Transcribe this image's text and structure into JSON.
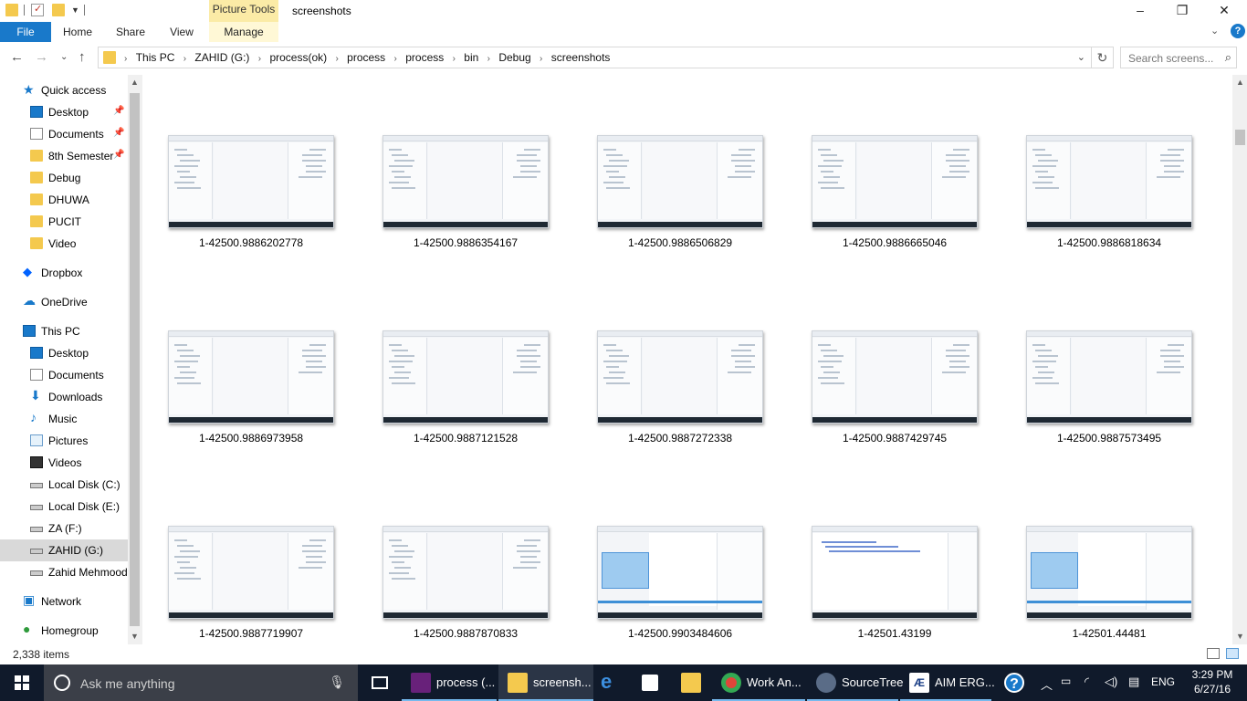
{
  "window": {
    "title": "screenshots",
    "context_tab": "Picture Tools"
  },
  "ribbon": {
    "tabs": [
      {
        "label": "File"
      },
      {
        "label": "Home"
      },
      {
        "label": "Share"
      },
      {
        "label": "View"
      },
      {
        "label": "Manage"
      }
    ]
  },
  "address": {
    "crumbs": [
      "This PC",
      "ZAHID (G:)",
      "process(ok)",
      "process",
      "process",
      "bin",
      "Debug",
      "screenshots"
    ]
  },
  "search": {
    "placeholder": "Search screens..."
  },
  "nav": {
    "items": [
      {
        "label": "Quick access",
        "icon": "star-icon",
        "pinned": false
      },
      {
        "label": "Desktop",
        "icon": "desktop-icon",
        "pinned": true
      },
      {
        "label": "Documents",
        "icon": "documents-icon",
        "pinned": true
      },
      {
        "label": "8th Semester",
        "icon": "folder-icon",
        "pinned": true
      },
      {
        "label": "Debug",
        "icon": "folder-icon",
        "pinned": false
      },
      {
        "label": "DHUWA",
        "icon": "folder-icon",
        "pinned": false
      },
      {
        "label": "PUCIT",
        "icon": "folder-icon",
        "pinned": false
      },
      {
        "label": "Video",
        "icon": "folder-icon",
        "pinned": false
      },
      {
        "label": "Dropbox",
        "icon": "dropbox-icon",
        "pinned": false
      },
      {
        "label": "OneDrive",
        "icon": "cloud-icon",
        "pinned": false
      },
      {
        "label": "This PC",
        "icon": "computer-icon",
        "pinned": false
      },
      {
        "label": "Desktop",
        "icon": "desktop-icon",
        "pinned": false
      },
      {
        "label": "Documents",
        "icon": "documents-icon",
        "pinned": false
      },
      {
        "label": "Downloads",
        "icon": "downloads-icon",
        "pinned": false
      },
      {
        "label": "Music",
        "icon": "music-icon",
        "pinned": false
      },
      {
        "label": "Pictures",
        "icon": "pictures-icon",
        "pinned": false
      },
      {
        "label": "Videos",
        "icon": "videos-icon",
        "pinned": false
      },
      {
        "label": "Local Disk (C:)",
        "icon": "drive-icon",
        "pinned": false
      },
      {
        "label": "Local Disk (E:)",
        "icon": "drive-icon",
        "pinned": false
      },
      {
        "label": "ZA (F:)",
        "icon": "drive-icon",
        "pinned": false
      },
      {
        "label": "ZAHID (G:)",
        "icon": "drive-icon",
        "pinned": false,
        "selected": true
      },
      {
        "label": "Zahid Mehmood",
        "icon": "drive-icon",
        "pinned": false
      },
      {
        "label": "Network",
        "icon": "network-icon",
        "pinned": false
      },
      {
        "label": "Homegroup",
        "icon": "homegroup-icon",
        "pinned": false
      }
    ]
  },
  "files": [
    {
      "name": "1-42500.9886202778",
      "kind": "ide"
    },
    {
      "name": "1-42500.9886354167",
      "kind": "ide"
    },
    {
      "name": "1-42500.9886506829",
      "kind": "ide"
    },
    {
      "name": "1-42500.9886665046",
      "kind": "ide"
    },
    {
      "name": "1-42500.9886818634",
      "kind": "ide"
    },
    {
      "name": "1-42500.9886973958",
      "kind": "ide"
    },
    {
      "name": "1-42500.9887121528",
      "kind": "ide"
    },
    {
      "name": "1-42500.9887272338",
      "kind": "ide"
    },
    {
      "name": "1-42500.9887429745",
      "kind": "ide"
    },
    {
      "name": "1-42500.9887573495",
      "kind": "ide"
    },
    {
      "name": "1-42500.9887719907",
      "kind": "ide"
    },
    {
      "name": "1-42500.9887870833",
      "kind": "ide"
    },
    {
      "name": "1-42500.9903484606",
      "kind": "app"
    },
    {
      "name": "1-42501.43199",
      "kind": "code"
    },
    {
      "name": "1-42501.44481",
      "kind": "app"
    }
  ],
  "status": {
    "item_count": "2,338 items"
  },
  "taskbar": {
    "search_placeholder": "Ask me anything",
    "apps": [
      {
        "label": "",
        "icon": "task-view-icon",
        "open": false
      },
      {
        "label": "process (...",
        "icon": "visual-studio-icon",
        "open": true
      },
      {
        "label": "screensh...",
        "icon": "file-explorer-icon",
        "open": true,
        "active": true
      },
      {
        "label": "",
        "icon": "edge-icon",
        "open": false
      },
      {
        "label": "",
        "icon": "store-icon",
        "open": false
      },
      {
        "label": "",
        "icon": "folder-icon",
        "open": false
      },
      {
        "label": "Work An...",
        "icon": "chrome-icon",
        "open": true
      },
      {
        "label": "SourceTree",
        "icon": "sourcetree-icon",
        "open": true
      },
      {
        "label": "AIM ERG...",
        "icon": "aim-icon",
        "open": true
      },
      {
        "label": "",
        "icon": "help-icon",
        "open": false
      }
    ],
    "language": "ENG",
    "time": "3:29 PM",
    "date": "6/27/16"
  },
  "colors": {
    "accent": "#1979ca",
    "taskbar": "#101a2b",
    "picture_tools": "#fbeba6",
    "selected_nav": "#d9d9d9"
  }
}
